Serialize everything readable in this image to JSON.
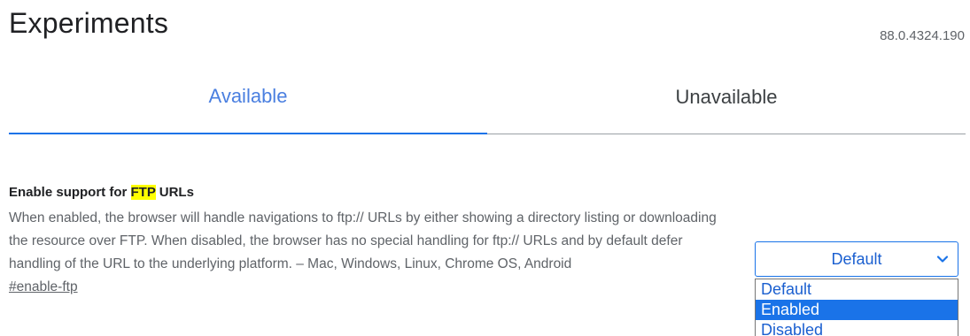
{
  "header": {
    "title": "Experiments",
    "version": "88.0.4324.190"
  },
  "tabs": [
    {
      "label": "Available",
      "active": true
    },
    {
      "label": "Unavailable",
      "active": false
    }
  ],
  "experiment": {
    "title_prefix": "Enable support for ",
    "title_highlight": "FTP",
    "title_suffix": " URLs",
    "description": "When enabled, the browser will handle navigations to ftp:// URLs by either showing a directory listing or downloading the resource over FTP. When disabled, the browser has no special handling for ftp:// URLs and by default defer handling of the URL to the underlying platform. – Mac, Windows, Linux, Chrome OS, Android",
    "link": "#enable-ftp",
    "select": {
      "value": "Default",
      "options": [
        "Default",
        "Enabled",
        "Disabled"
      ],
      "highlighted_option": "Enabled"
    }
  },
  "colors": {
    "accent": "#1a73e8",
    "highlight": "#ffff00"
  },
  "icons": {
    "dropdown": "chevron-down-icon"
  }
}
